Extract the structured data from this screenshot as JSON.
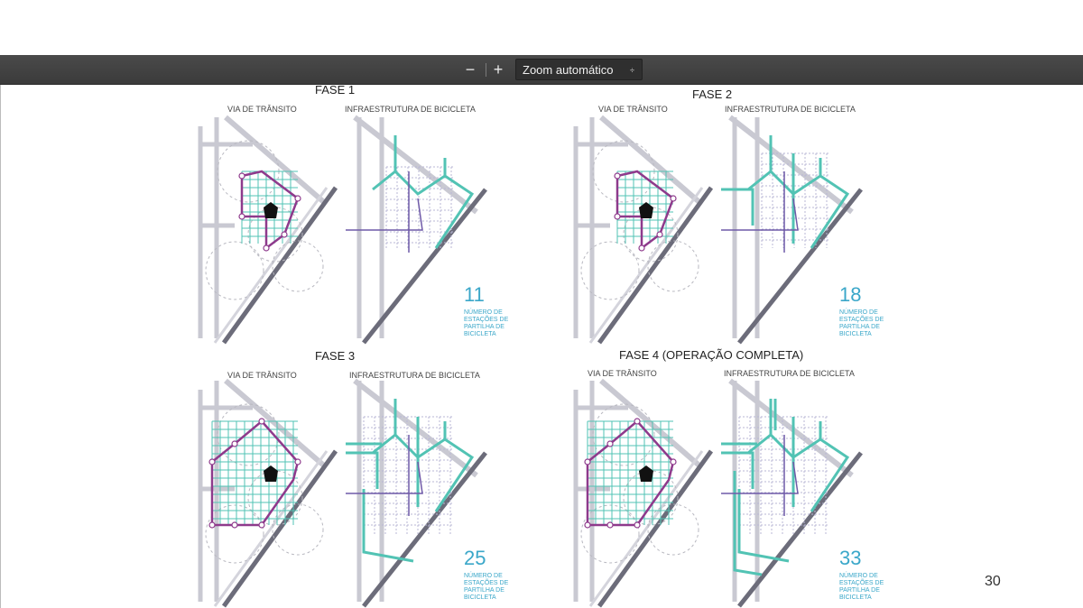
{
  "toolbar": {
    "zoom_out_label": "−",
    "zoom_in_label": "+",
    "zoom_value": "Zoom automático",
    "zoom_arrow": "÷"
  },
  "document": {
    "page_number": "30",
    "phases": [
      {
        "title": "FASE 1",
        "left_label": "VIA DE TRÂNSITO",
        "right_label": "INFRAESTRUTURA DE BICICLETA",
        "count": "11",
        "caption": [
          "NÚMERO DE",
          "ESTAÇÕES DE",
          "PARTILHA DE",
          "BICICLETA"
        ]
      },
      {
        "title": "FASE 2",
        "left_label": "VIA DE TRÂNSITO",
        "right_label": "INFRAESTRUTURA DE BICICLETA",
        "count": "18",
        "caption": [
          "NÚMERO DE",
          "ESTAÇÕES DE",
          "PARTILHA DE",
          "BICICLETA"
        ]
      },
      {
        "title": "FASE 3",
        "left_label": "VIA DE TRÂNSITO",
        "right_label": "INFRAESTRUTURA DE BICICLETA",
        "count": "25",
        "caption": [
          "NÚMERO DE",
          "ESTAÇÕES DE",
          "PARTILHA DE",
          "BICICLETA"
        ]
      },
      {
        "title": "FASE 4 (OPERAÇÃO COMPLETA)",
        "left_label": "VIA DE TRÂNSITO",
        "right_label": "INFRAESTRUTURA DE BICICLETA",
        "count": "33",
        "caption": [
          "NÚMERO DE",
          "ESTAÇÕES DE",
          "PARTILHA DE",
          "BICICLETA"
        ]
      }
    ]
  },
  "colors": {
    "transit_route": "#8e3a8c",
    "bike_network": "#52c3b4",
    "count_text": "#3aa7c9",
    "street_lines": "#c9c9d2",
    "highway": "#6c6c7a"
  }
}
